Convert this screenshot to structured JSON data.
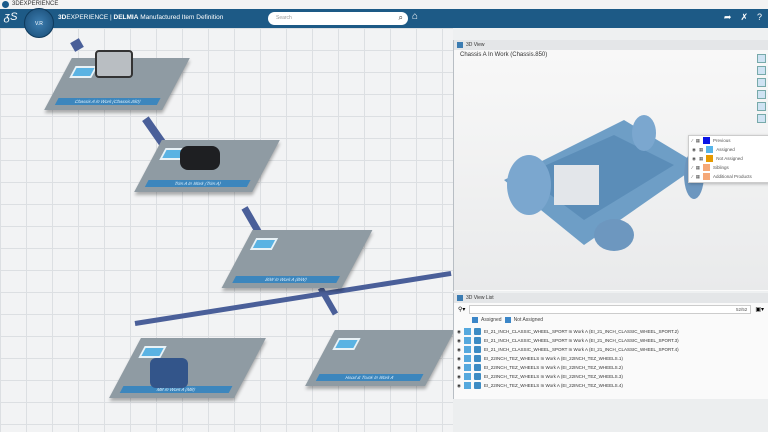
{
  "window": {
    "title": "3DEXPERIENCE"
  },
  "topbar": {
    "brand": "3D",
    "brand_rest": "EXPERIENCE | ",
    "product": "DELMIA",
    "app": "Manufactured Item Definition",
    "search_placeholder": "Search",
    "compass_label": "V.R"
  },
  "canvas": {
    "nodes": [
      {
        "label": "Chassis A In Work (Chassis.850)"
      },
      {
        "label": "Trim A In Work (Trim A)"
      },
      {
        "label": "BiW In Work A (BiW)"
      },
      {
        "label": "Hood & Trunk In Work A"
      },
      {
        "label": "MB In Work A (MB)"
      }
    ]
  },
  "view3d": {
    "tab": "3D View",
    "title": "Chassis A In Work (Chassis.850)",
    "legend": [
      {
        "label": "Previous",
        "color": "#0a14e6"
      },
      {
        "label": "Assigned",
        "color": "#56b4e9"
      },
      {
        "label": "Not Assigned",
        "color": "#e69a00"
      },
      {
        "label": "Siblings",
        "color": "#f5a878"
      },
      {
        "label": "Additional Products",
        "color": "#f5a878"
      }
    ]
  },
  "list": {
    "tab": "3D View List",
    "count": "52/52",
    "filter_assigned": "Assigned",
    "filter_not_assigned": "Not Assigned",
    "items": [
      "EI_21_INCH_CLASSIC_WHEEL_SPORT In Work A (EI_21_INCH_CLASSIC_WHEEL_SPORT.2)",
      "EI_21_INCH_CLASSIC_WHEEL_SPORT In Work A (EI_21_INCH_CLASSIC_WHEEL_SPORT.3)",
      "EI_21_INCH_CLASSIC_WHEEL_SPORT In Work A (EI_21_INCH_CLASSIC_WHEEL_SPORT.4)",
      "EI_22INCH_TEZ_WHEELS In Work A (EI_22INCH_TEZ_WHEELS.1)",
      "EI_22INCH_TEZ_WHEELS In Work A (EI_22INCH_TEZ_WHEELS.2)",
      "EI_22INCH_TEZ_WHEELS In Work A (EI_22INCH_TEZ_WHEELS.3)",
      "EI_22INCH_TEZ_WHEELS In Work A (EI_22INCH_TEZ_WHEELS.4)"
    ]
  }
}
